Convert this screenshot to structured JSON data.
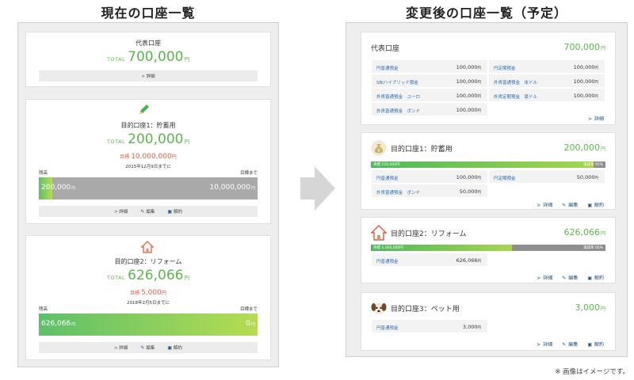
{
  "headings": {
    "current": "現在の口座一覧",
    "after": "変更後の口座一覧（予定）"
  },
  "left": {
    "rep": {
      "title": "代表口座",
      "total_label": "TOTAL",
      "amount": "700,000",
      "yen": "円",
      "detail": "> 詳細"
    },
    "goal1": {
      "title": "目的口座1：貯蓄用",
      "total_label": "TOTAL",
      "amount": "200,000",
      "yen": "円",
      "target_label": "目標",
      "target": "10,000,000",
      "target_yen": "円",
      "date": "2015年12月9日までに",
      "balance_label": "残高",
      "until_label": "目標まで",
      "balance": "200,000",
      "remain": "10,000,000",
      "bar_yen": "円",
      "progress": 0.06,
      "detail": "> 詳細",
      "edit": "編集",
      "cancel": "解約"
    },
    "goal2": {
      "title": "目的口座2：リフォーム",
      "total_label": "TOTAL",
      "amount": "626,066",
      "yen": "円",
      "target_label": "目標",
      "target": "5,000",
      "target_yen": "円",
      "date": "2018年2月5日までに",
      "balance_label": "残高",
      "until_label": "目標まで",
      "balance": "626,066",
      "remain": "0",
      "bar_yen": "円",
      "progress": 1.0,
      "detail": "> 詳細",
      "edit": "編集",
      "cancel": "解約"
    }
  },
  "right": {
    "rep": {
      "title": "代表口座",
      "amount": "700,000",
      "yen": "円",
      "items": [
        {
          "name": "円普通預金",
          "value": "100,000"
        },
        {
          "name": "円定期預金",
          "value": "100,000"
        },
        {
          "name": "SBIハイブリッド預金",
          "value": "100,000"
        },
        {
          "name": "外貨普通預金　米ドル",
          "value": "100,000"
        },
        {
          "name": "外貨普通預金　ユーロ",
          "value": "100,000"
        },
        {
          "name": "外貨定期預金　豪ドル",
          "value": "100,000"
        },
        {
          "name": "外貨普通預金　ポンド",
          "value": "100,000"
        }
      ],
      "cell_yen": "円",
      "detail": "詳細"
    },
    "goal1": {
      "title": "目的口座1：貯蓄用",
      "amount": "200,000",
      "yen": "円",
      "bar_left": "目標 220,000円",
      "bar_right": "達成率 95%",
      "progress": 0.95,
      "items": [
        {
          "name": "円普通預金",
          "value": "100,000"
        },
        {
          "name": "円定期預金",
          "value": "50,000"
        },
        {
          "name": "外貨普通預金　ポンド",
          "value": "50,000"
        }
      ],
      "cell_yen": "円",
      "detail": "詳細",
      "edit": "編集",
      "cancel": "解約"
    },
    "goal2": {
      "title": "目的口座2：リフォーム",
      "amount": "626,066",
      "yen": "円",
      "bar_left": "目標 1,000,000円",
      "bar_right": "達成率 60%",
      "progress": 0.6,
      "items": [
        {
          "name": "円普通預金",
          "value": "626,066"
        }
      ],
      "cell_yen": "円",
      "detail": "詳細",
      "edit": "編集",
      "cancel": "解約"
    },
    "goal3": {
      "title": "目的口座3：ペット用",
      "amount": "3,000",
      "yen": "円",
      "items": [
        {
          "name": "円普通預金",
          "value": "3,000"
        }
      ],
      "cell_yen": "円",
      "detail": "詳細",
      "edit": "編集",
      "cancel": "解約"
    }
  },
  "note": "※ 画像はイメージです。",
  "colors": {
    "accent_green": "#5ab84a",
    "target_red": "#e55d4b",
    "link_blue": "#2c6db3",
    "bar_gray": "#a9a9a9"
  },
  "icons": [
    "pencil-icon",
    "house-icon",
    "money-bag-icon",
    "dog-icon",
    "edit-icon",
    "cancel-icon",
    "arrow-right-icon"
  ]
}
